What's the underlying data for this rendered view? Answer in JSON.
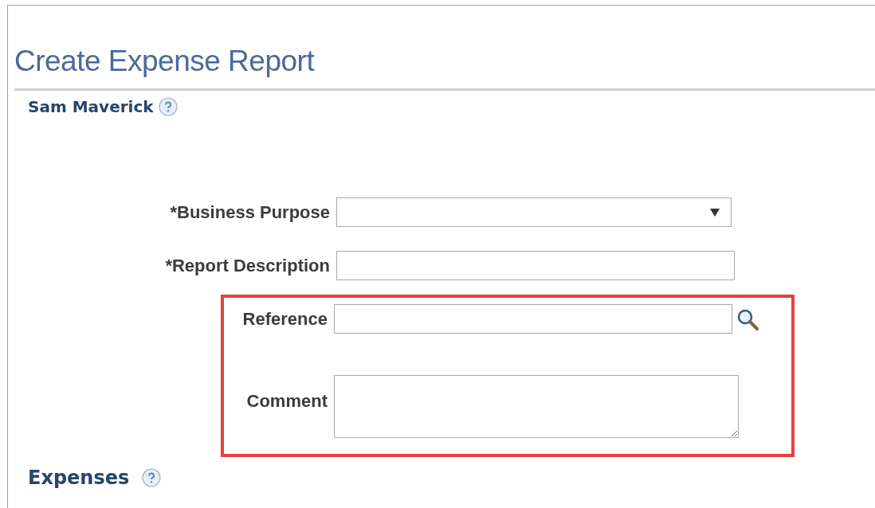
{
  "page": {
    "title": "Create Expense Report"
  },
  "employee": {
    "name": "Sam Maverick"
  },
  "groups": [
    {
      "highlighted": false,
      "fields": [
        {
          "kind": "select",
          "label": "*Business Purpose"
        },
        {
          "kind": "text",
          "label": "*Report Description"
        }
      ]
    },
    {
      "highlighted": true,
      "fields": [
        {
          "kind": "lookup",
          "label": "Reference"
        },
        {
          "kind": "textarea",
          "label": "Comment"
        }
      ]
    }
  ],
  "section": {
    "title": "Expenses"
  }
}
